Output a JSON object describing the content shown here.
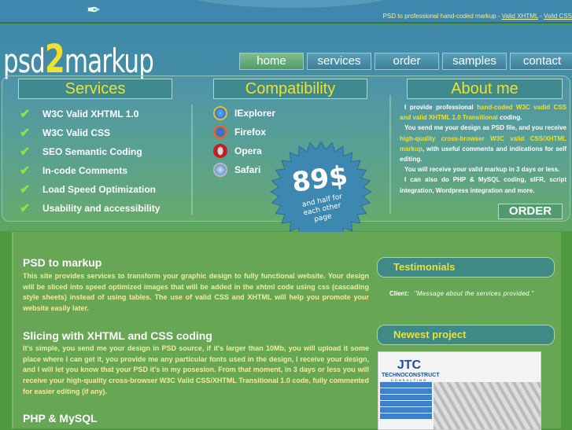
{
  "topbar": {
    "tagline": "PSD to professional hand-coded markup - ",
    "link1": "Valid XHTML",
    "sep": " - ",
    "link2": "Valid CSS"
  },
  "logo": {
    "pre": "psd",
    "num": "2",
    "post": "markup"
  },
  "nav": [
    "home",
    "services",
    "order",
    "samples",
    "contact"
  ],
  "services": {
    "title": "Services",
    "items": [
      "W3C Valid XHTML 1.0",
      "W3C Valid CSS",
      "SEO Semantic Coding",
      "In-code Comments",
      "Load Speed Optimization",
      "Usability and accessibility"
    ]
  },
  "compat": {
    "title": "Compatibility",
    "items": [
      "IExplorer",
      "Firefox",
      "Opera",
      "Safari"
    ]
  },
  "price": {
    "amount": "89$",
    "l1": "and half for",
    "l2": "each other",
    "l3": "page"
  },
  "about": {
    "title": "About me",
    "p1a": "I provide professional ",
    "p1b": "hand-coded W3C vadid CSS and valid XHTML 1.0 Transitional",
    "p1c": " coding.",
    "p2a": "You send me your design as PSD file, and you receive ",
    "p2b": "high-quality cross-browser W3C valid CSS/XHTML markup",
    "p2c": ", with useful comments and indications for self editing.",
    "p3": "You will receive your valid markup in 3 days or less.",
    "p4": "I can also do PHP & MySQL coding, sIFR, script integration, Wordpress integration and more.",
    "order": "ORDER"
  },
  "main": {
    "s1_title": "PSD to markup",
    "s1_text": "This site provides services to transform your graphic design to fully functional website. Your design will be sliced into speed optimized images that will be added in the xhtml code using css (cascading style sheets) instead of using tables. The use of valid CSS and XHTML will help you promote your website easily later.",
    "s2_title": "Slicing with XHTML and CSS coding",
    "s2_text": "It's simple, you send me your design in PSD source, if it's larger than 10Mb, you will upload it some place where I can get it, you provide me any particular fonts used in the design, I receive your design, and I will let you know that your PSD it's in my posesion. From that moment, in 3 days or less you will receive your high-quality cross-browser W3C Valid CSS/XHTML Transitional 1.0 code, fully commented for easier editing (if any).",
    "s3_title": "PHP & MySQL"
  },
  "sidebar": {
    "testimonials": "Testimonials",
    "client_label": "Client:",
    "client_quote": "\"Message about the services provided.\"",
    "newest": "Newest project",
    "project_logo": "TECHNOCONSTRUCT",
    "project_sub": "CONSULTING"
  }
}
